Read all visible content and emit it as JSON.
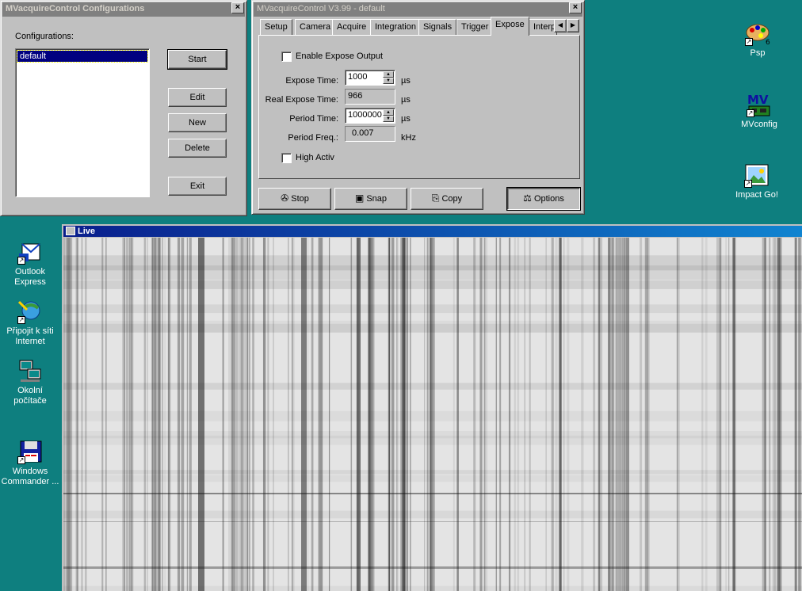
{
  "config_window": {
    "title": "MVacquireControl Configurations",
    "configurations_label": "Configurations:",
    "list_items": [
      "default"
    ],
    "buttons": {
      "start": "Start",
      "edit": "Edit",
      "new": "New",
      "delete": "Delete",
      "exit": "Exit"
    }
  },
  "main_window": {
    "title": "MVacquireControl  V3.99 - default",
    "tabs": [
      "Setup",
      "Camera",
      "Acquire",
      "Integration",
      "Signals",
      "Trigger",
      "Expose",
      "Interp"
    ],
    "active_tab": "Expose",
    "expose": {
      "enable_output_label": "Enable Expose Output",
      "expose_time_label": "Expose Time:",
      "expose_time_value": "1000",
      "expose_time_unit": "µs",
      "real_expose_label": "Real Expose Time:",
      "real_expose_value": "966",
      "real_expose_unit": "µs",
      "period_time_label": "Period Time:",
      "period_time_value": "1000000",
      "period_time_unit": "µs",
      "period_freq_label": "Period Freq.:",
      "period_freq_value": "0.007",
      "period_freq_unit": "kHz",
      "high_activ_label": "High Activ"
    },
    "buttons": {
      "stop": "Stop",
      "snap": "Snap",
      "copy": "Copy",
      "options": "Options"
    }
  },
  "live_window": {
    "title": "Live"
  },
  "desktop_icons": {
    "psp": "Psp",
    "mvconfig": "MVconfig",
    "impact": "Impact Go!",
    "outlook": [
      "Outlook",
      "Express"
    ],
    "pripojit": [
      "Připojit k síti",
      "Internet"
    ],
    "okolni": [
      "Okolní",
      "počítače"
    ],
    "wincmd": [
      "Windows",
      "Commander ..."
    ]
  },
  "colors": {
    "desktop": "#0e7f7f",
    "face": "#c0c0c0",
    "selection": "#000080"
  }
}
